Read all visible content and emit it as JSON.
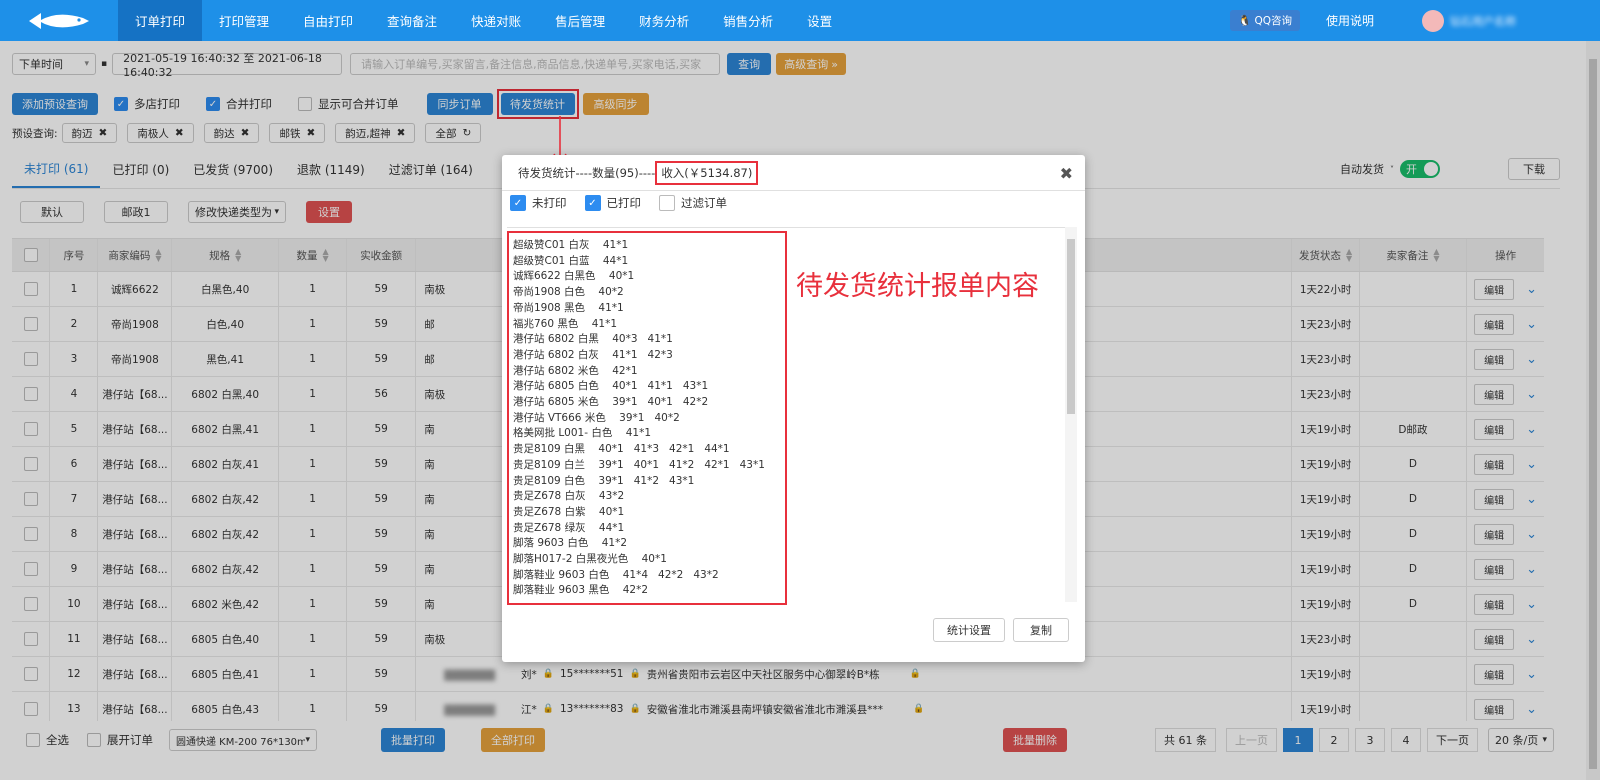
{
  "nav": {
    "items": [
      "订单打印",
      "打印管理",
      "自由打印",
      "查询备注",
      "快递对账",
      "售后管理",
      "财务分析",
      "销售分析",
      "设置"
    ],
    "qq": "QQ咨询",
    "usage": "使用说明",
    "user": "钻石用户名称"
  },
  "filter": {
    "time_select": "下单时间",
    "date_range": "2021-05-19 16:40:32 至 2021-06-18 16:40:32",
    "search_placeholder": "请输入订单编号,买家留言,备注信息,商品信息,快递单号,买家电话,买家",
    "query_btn": "查询",
    "advanced_btn": "高级查询"
  },
  "actions": {
    "add_preset": "添加预设查询",
    "multi_shop": "多店打印",
    "merge_print": "合并打印",
    "show_mergeable": "显示可合并订单",
    "sync_orders": "同步订单",
    "pending_stats": "待发货统计",
    "adv_sync": "高级同步"
  },
  "presets": {
    "label": "预设查询:",
    "tags": [
      "韵迈",
      "南极人",
      "韵达",
      "邮铁",
      "韵迈,超神",
      "全部"
    ]
  },
  "tabs": [
    "未打印 (61)",
    "已打印 (0)",
    "已发货 (9700)",
    "退款 (1149)",
    "过滤订单 (164)"
  ],
  "auto_ship": "自动发货",
  "auto_ship_state": "开",
  "download": "下载",
  "subbar": {
    "default": "默认",
    "post": "邮政1",
    "modify_type": "修改快递类型为",
    "set": "设置"
  },
  "table": {
    "headers": [
      "序号",
      "商家编码",
      "规格",
      "数量",
      "实收金额",
      "发货状态",
      "卖家备注",
      "操作"
    ],
    "edit": "编辑",
    "rows": [
      {
        "no": "1",
        "code": "诚辉6622",
        "spec": "白黑色,40",
        "qty": "1",
        "amount": "59",
        "shop": "南极",
        "status": "1天22小时",
        "note": ""
      },
      {
        "no": "2",
        "code": "帝尚1908",
        "spec": "白色,40",
        "qty": "1",
        "amount": "59",
        "shop": "邮",
        "status": "1天23小时",
        "note": ""
      },
      {
        "no": "3",
        "code": "帝尚1908",
        "spec": "黑色,41",
        "qty": "1",
        "amount": "59",
        "shop": "邮",
        "status": "1天23小时",
        "note": ""
      },
      {
        "no": "4",
        "code": "港仔站【68...",
        "spec": "6802 白黑,40",
        "qty": "1",
        "amount": "56",
        "shop": "南极",
        "status": "1天23小时",
        "note": ""
      },
      {
        "no": "5",
        "code": "港仔站【68...",
        "spec": "6802 白黑,41",
        "qty": "1",
        "amount": "59",
        "shop": "南",
        "status": "1天19小时",
        "note": "D邮政"
      },
      {
        "no": "6",
        "code": "港仔站【68...",
        "spec": "6802 白灰,41",
        "qty": "1",
        "amount": "59",
        "shop": "南",
        "status": "1天19小时",
        "note": "D"
      },
      {
        "no": "7",
        "code": "港仔站【68...",
        "spec": "6802 白灰,42",
        "qty": "1",
        "amount": "59",
        "shop": "南",
        "status": "1天19小时",
        "note": "D"
      },
      {
        "no": "8",
        "code": "港仔站【68...",
        "spec": "6802 白灰,42",
        "qty": "1",
        "amount": "59",
        "shop": "南",
        "status": "1天19小时",
        "note": "D"
      },
      {
        "no": "9",
        "code": "港仔站【68...",
        "spec": "6802 白灰,42",
        "qty": "1",
        "amount": "59",
        "shop": "南",
        "status": "1天19小时",
        "note": "D"
      },
      {
        "no": "10",
        "code": "港仔站【68...",
        "spec": "6802 米色,42",
        "qty": "1",
        "amount": "59",
        "shop": "南",
        "status": "1天19小时",
        "note": "D"
      },
      {
        "no": "11",
        "code": "港仔站【68...",
        "spec": "6805 白色,40",
        "qty": "1",
        "amount": "59",
        "shop": "南极",
        "status": "1天23小时",
        "note": ""
      },
      {
        "no": "12",
        "code": "港仔站【68...",
        "spec": "6805 白色,41",
        "qty": "1",
        "amount": "59",
        "shop": "",
        "buyer": "刘*",
        "phone": "15*******51",
        "addr": "贵州省贵阳市云岩区中天社区服务中心御翠岭B*栋",
        "status": "1天19小时",
        "note": ""
      },
      {
        "no": "13",
        "code": "港仔站【68...",
        "spec": "6805 白色,43",
        "qty": "1",
        "amount": "59",
        "shop": "",
        "buyer": "江*",
        "phone": "13*******83",
        "addr": "安徽省淮北市濉溪县南坪镇安徽省淮北市濉溪县***",
        "status": "1天19小时",
        "note": ""
      }
    ]
  },
  "bottom": {
    "select_all": "全选",
    "expand": "展开订单",
    "printer": "圆通快递 KM-200 76*130mm",
    "batch_print": "批量打印",
    "all_print": "全部打印",
    "batch_delete": "批量删除",
    "total": "共 61 条",
    "prev": "上一页",
    "pages": [
      "1",
      "2",
      "3",
      "4"
    ],
    "next": "下一页",
    "per_page": "20 条/页"
  },
  "modal": {
    "title_prefix": "待发货统计----数量(95)----",
    "income": "收入(￥5134.87)",
    "filters": {
      "unprinted": "未打印",
      "printed": "已打印",
      "filtered": "过滤订单"
    },
    "lines": [
      "超级赞C01 白灰    41*1",
      "超级赞C01 白蓝    44*1",
      "诚辉6622 白黑色    40*1",
      "帝尚1908 白色    40*2",
      "帝尚1908 黑色    41*1",
      "福兆760 黑色    41*1",
      "港仔站 6802 白黑    40*3   41*1",
      "港仔站 6802 白灰    41*1   42*3",
      "港仔站 6802 米色    42*1",
      "港仔站 6805 白色    40*1   41*1   43*1",
      "港仔站 6805 米色    39*1   40*1   42*2",
      "港仔站 VT666 米色    39*1   40*2",
      "格美网批 L001- 白色    41*1",
      "贵足8109 白黑    40*1   41*3   42*1   44*1",
      "贵足8109 白兰    39*1   40*1   41*2   42*1   43*1",
      "贵足8109 白色    39*1   41*2   43*1",
      "贵足Z678 白灰    43*2",
      "贵足Z678 白紫    40*1",
      "贵足Z678 绿灰    44*1",
      "脚落 9603 白色    41*2",
      "脚落H017-2 白黑夜光色    40*1",
      "脚落鞋业 9603 白色    41*4   42*2   43*2",
      "脚落鞋业 9603 黑色    42*2"
    ],
    "stats_settings": "统计设置",
    "copy": "复制",
    "annotation": "待发货统计报单内容"
  }
}
